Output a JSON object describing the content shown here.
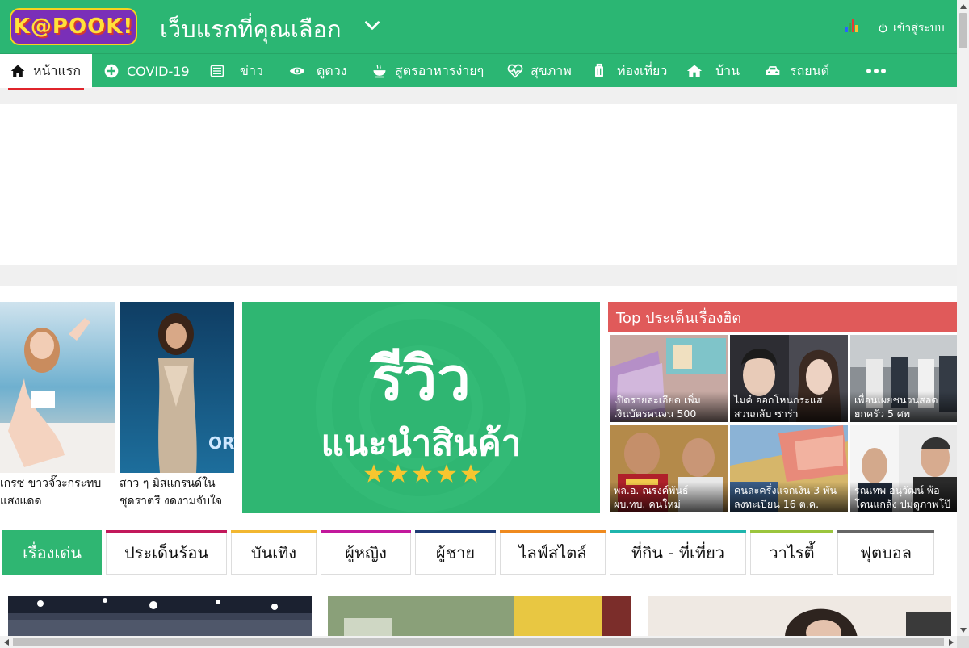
{
  "header": {
    "logo_text": "K@POOK!",
    "tagline": "เว็บแรกที่คุณเลือก",
    "login_label": "เข้าสู่ระบบ"
  },
  "nav": {
    "items": [
      {
        "label": "หน้าแรก",
        "icon": "home-icon"
      },
      {
        "label": "COVID-19",
        "icon": "plus-circle-icon"
      },
      {
        "label": "ข่าว",
        "icon": "newspaper-icon"
      },
      {
        "label": "ดูดวง",
        "icon": "eye-icon"
      },
      {
        "label": "สูตรอาหารง่ายๆ",
        "icon": "food-bowl-icon"
      },
      {
        "label": "สุขภาพ",
        "icon": "heart-pulse-icon"
      },
      {
        "label": "ท่องเที่ยว",
        "icon": "luggage-icon"
      },
      {
        "label": "บ้าน",
        "icon": "house-icon"
      },
      {
        "label": "รถยนต์",
        "icon": "car-icon"
      }
    ]
  },
  "feature": {
    "tiles": [
      {
        "caption_line1": "เกรซ ขาวจั๊วะกระทบ",
        "caption_line2": "แสงแดด"
      },
      {
        "caption_line1": "สาว ๆ มิสแกรนด์ใน",
        "caption_line2": "ชุดราตรี งดงามจับใจ"
      }
    ],
    "review_title": "รีวิว",
    "review_subtitle": "แนะนำสินค้า",
    "review_stars": 5
  },
  "top_hot": {
    "title": "Top ประเด็นเรื่องฮิต",
    "items": [
      {
        "line1": "เปิดรายละเอียด เพิ่ม",
        "line2": "เงินบัตรคนจน 500"
      },
      {
        "line1": "ไมค์ ออกโหนกระแส",
        "line2": "สวนกลับ ซาร่า"
      },
      {
        "line1": "เพื่อนเผยชนวนสลด",
        "line2": "ยกครัว 5 ศพ"
      },
      {
        "line1": "พล.อ. ณรงค์พันธ์",
        "line2": "ผบ.ทบ. คนใหม่"
      },
      {
        "line1": "คนละครึ่งแจกเงิน 3 พัน",
        "line2": "ลงทะเบียน 16 ต.ค."
      },
      {
        "line1": "รณเทพ อนุวัฒน์ พ้อ",
        "line2": "โดนแกล้ง ปมดูภาพโป๊"
      }
    ]
  },
  "tabs": [
    {
      "label": "เรื่องเด่น",
      "color": "#2fb672"
    },
    {
      "label": "ประเด็นร้อน",
      "color": "#c2185b"
    },
    {
      "label": "บันเทิง",
      "color": "#f2b731"
    },
    {
      "label": "ผู้หญิง",
      "color": "#c2189c"
    },
    {
      "label": "ผู้ชาย",
      "color": "#1f3b73"
    },
    {
      "label": "ไลฟ์สไตล์",
      "color": "#ef8a1f"
    },
    {
      "label": "ที่กิน - ที่เที่ยว",
      "color": "#1fb5ad"
    },
    {
      "label": "วาไรตี้",
      "color": "#9bc53d"
    },
    {
      "label": "ฟุตบอล",
      "color": "#666666"
    }
  ],
  "colors": {
    "brand_green": "#2bb673",
    "hot_red": "#e05a5a",
    "nav_active_underline": "#e0242b"
  }
}
